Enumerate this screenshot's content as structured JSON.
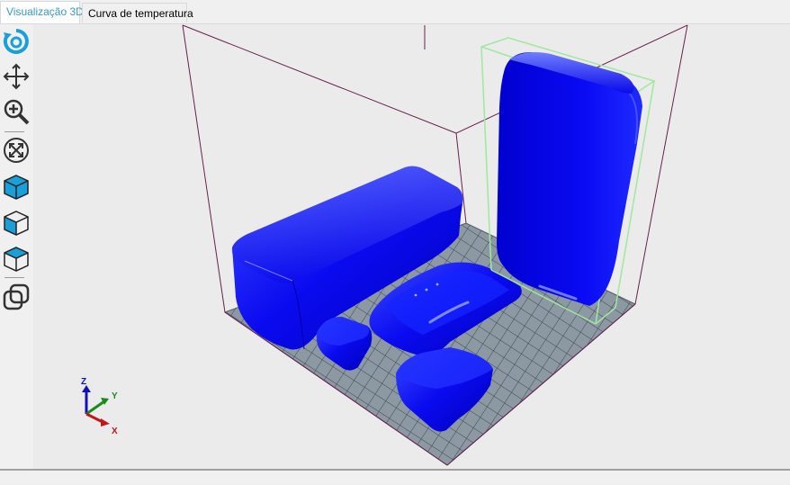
{
  "tabs": [
    {
      "label": "Visualização 3D",
      "active": true
    },
    {
      "label": "Curva de temperatura",
      "active": false
    }
  ],
  "toolbar": {
    "tools": [
      {
        "name": "rotate-view",
        "icon": "rotate-icon"
      },
      {
        "name": "move-view",
        "icon": "move-arrows-icon"
      },
      {
        "name": "zoom-view",
        "icon": "zoom-in-icon"
      },
      {
        "name": "fit-view",
        "icon": "fit-to-view-icon"
      },
      {
        "name": "iso-view",
        "icon": "iso-cube-icon"
      },
      {
        "name": "front-view",
        "icon": "front-cube-icon"
      },
      {
        "name": "top-view",
        "icon": "top-cube-icon"
      },
      {
        "name": "toggle-objects",
        "icon": "overlap-squares-icon"
      }
    ],
    "accent_color": "#1a9fd8"
  },
  "scene": {
    "background_color": "#ebebeb",
    "bed_color": "#8c99a3",
    "object_color": "#0808e8",
    "selection_color": "#9fe89f",
    "frame_color": "#6a2050",
    "axes": {
      "x": "X",
      "y": "Y",
      "z": "Z"
    }
  }
}
